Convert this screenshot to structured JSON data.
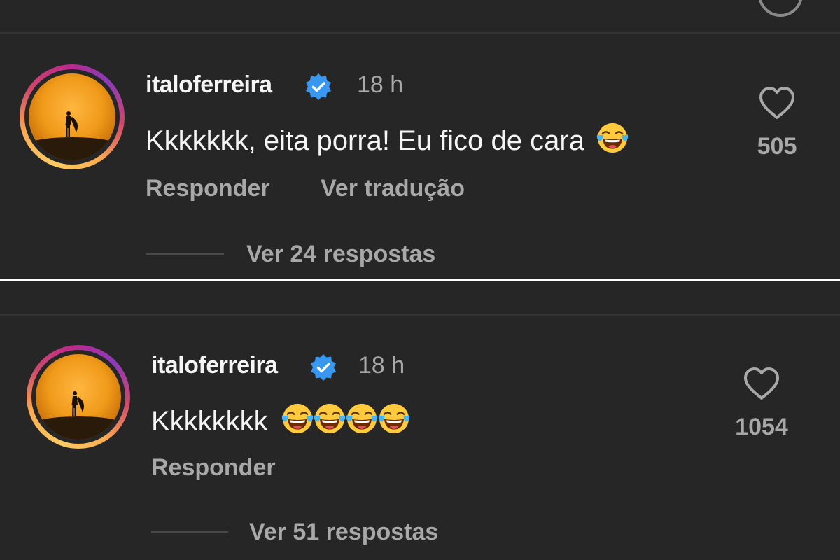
{
  "comments": [
    {
      "username": "italoferreira",
      "time": "18 h",
      "text": "Kkkkkkk, eita porra! Eu fico de cara",
      "emojis": [
        "face-with-tears-of-joy"
      ],
      "likes": "505",
      "reply_label": "Responder",
      "translate_label": "Ver tradução",
      "view_replies": "Ver 24 respostas"
    },
    {
      "username": "italoferreira",
      "time": "18 h",
      "text": "Kkkkkkkk",
      "emojis": [
        "face-with-tears-of-joy",
        "face-with-tears-of-joy",
        "face-with-tears-of-joy",
        "face-with-tears-of-joy"
      ],
      "likes": "1054",
      "reply_label": "Responder",
      "view_replies": "Ver 51 respostas"
    }
  ],
  "colors": {
    "background": "#262626",
    "primary_text": "#f5f5f5",
    "secondary_text": "#a8a8a8",
    "verified": "#3897f0"
  }
}
